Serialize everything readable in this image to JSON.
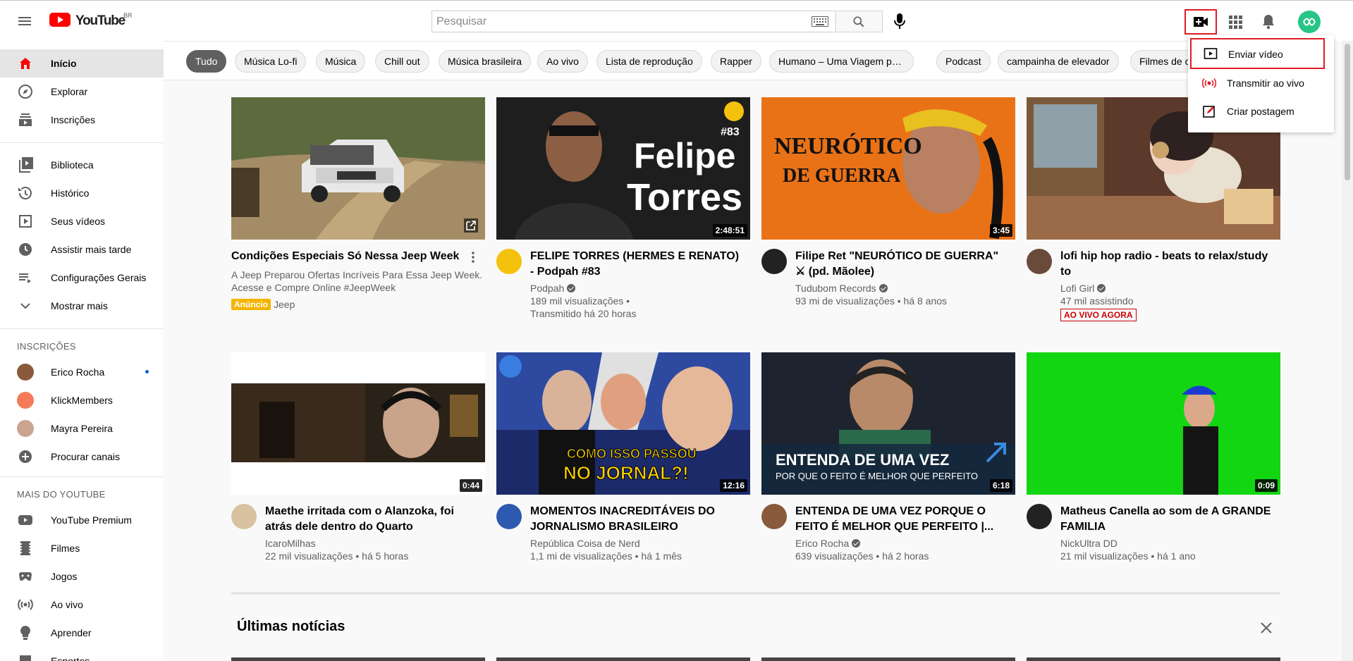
{
  "header": {
    "logo_text": "YouTube",
    "country_code": "BR",
    "search_placeholder": "Pesquisar",
    "icons": [
      "menu-icon",
      "youtube-logo",
      "keyboard-icon",
      "search-icon",
      "mic-icon",
      "create-video-icon",
      "apps-grid-icon",
      "bell-icon",
      "avatar"
    ]
  },
  "create_menu": {
    "items": [
      {
        "label": "Enviar vídeo",
        "icon": "upload-video-icon"
      },
      {
        "label": "Transmitir ao vivo",
        "icon": "live-broadcast-icon"
      },
      {
        "label": "Criar postagem",
        "icon": "create-post-icon"
      }
    ]
  },
  "sidebar": {
    "main": [
      {
        "label": "Início",
        "icon": "home-icon",
        "active": true
      },
      {
        "label": "Explorar",
        "icon": "explore-icon"
      },
      {
        "label": "Inscrições",
        "icon": "subscriptions-icon"
      }
    ],
    "library": [
      {
        "label": "Biblioteca",
        "icon": "library-icon"
      },
      {
        "label": "Histórico",
        "icon": "history-icon"
      },
      {
        "label": "Seus vídeos",
        "icon": "your-videos-icon"
      },
      {
        "label": "Assistir mais tarde",
        "icon": "watch-later-icon"
      },
      {
        "label": "Configurações Gerais",
        "icon": "playlist-icon"
      },
      {
        "label": "Mostrar mais",
        "icon": "chevron-down-icon"
      }
    ],
    "subscriptions_heading": "INSCRIÇÕES",
    "subscriptions": [
      {
        "label": "Erico Rocha",
        "new": true
      },
      {
        "label": "KlickMembers"
      },
      {
        "label": "Mayra Pereira"
      },
      {
        "label": "Procurar canais",
        "icon": "add-circle-icon"
      }
    ],
    "more_heading": "MAIS DO YOUTUBE",
    "more": [
      {
        "label": "YouTube Premium",
        "icon": "youtube-premium-icon"
      },
      {
        "label": "Filmes",
        "icon": "movies-icon"
      },
      {
        "label": "Jogos",
        "icon": "gaming-icon"
      },
      {
        "label": "Ao vivo",
        "icon": "live-icon"
      },
      {
        "label": "Aprender",
        "icon": "learning-icon"
      },
      {
        "label": "Esportes",
        "icon": "sports-icon"
      }
    ]
  },
  "chips": [
    "Tudo",
    "Música Lo-fi",
    "Música",
    "Chill out",
    "Música brasileira",
    "Ao vivo",
    "Lista de reprodução",
    "Rapper",
    "Humano – Uma Viagem pela ...",
    "Podcast",
    "campainha de elevador",
    "Filmes de c"
  ],
  "videos": {
    "ad": {
      "title": "Condições Especiais Só Nessa Jeep Week",
      "description": "A Jeep Preparou Ofertas Incríveis Para Essa Jeep Week. Acesse e Compre Online #JeepWeek",
      "badge": "Anúncio",
      "advertiser": "Jeep"
    },
    "row1": [
      {
        "title": "FELIPE TORRES (HERMES E RENATO) - Podpah #83",
        "channel": "Podpah",
        "verified": true,
        "meta": "189 mil visualizações •",
        "meta2": "Transmitido há 20 horas",
        "duration": "2:48:51"
      },
      {
        "title": "Filipe Ret \"NEURÓTICO DE GUERRA\" ⚔ (pd. Mãolee)",
        "channel": "Tudubom Records",
        "verified": true,
        "meta": "93 mi de visualizações • há 8 anos",
        "duration": "3:45"
      },
      {
        "title": "lofi hip hop radio - beats to relax/study to",
        "channel": "Lofi Girl",
        "verified": true,
        "meta": "47 mil assistindo",
        "live_badge": "AO VIVO AGORA"
      }
    ],
    "row2": [
      {
        "title": "Maethe irritada com o Alanzoka, foi atrás dele dentro do Quarto mandando...",
        "channel": "IcaroMilhas",
        "meta": "22 mil visualizações • há 5 horas",
        "duration": "0:44"
      },
      {
        "title": "MOMENTOS INACREDITÁVEIS DO JORNALISMO BRASILEIRO",
        "channel": "República Coisa de Nerd",
        "meta": "1,1 mi de visualizações • há 1 mês",
        "duration": "12:16"
      },
      {
        "title": "ENTENDA DE UMA VEZ PORQUE O FEITO É MELHOR QUE PERFEITO |...",
        "channel": "Erico Rocha",
        "verified": true,
        "meta": "639 visualizações • há 2 horas",
        "duration": "6:18"
      },
      {
        "title": "Matheus Canella ao som de A GRANDE FAMILIA",
        "channel": "NickUltra DD",
        "meta": "21 mil visualizações • há 1 ano",
        "duration": "0:09"
      }
    ]
  },
  "thumb_text": {
    "felipe1": "Felipe",
    "felipe2": "Torres",
    "episode": "#83",
    "neurotico1": "NEURÓTICO",
    "neurotico2": "DE GUERRA",
    "jornal1": "COMO ISSO PASSOU",
    "jornal2": "NO JORNAL?!",
    "entenda1": "ENTENDA DE UMA VEZ",
    "entenda2": "POR QUE O FEITO É MELHOR QUE PERFEITO"
  },
  "news": {
    "title": "Últimas notícias"
  },
  "colors": {
    "brand_red": "#ff0000",
    "highlight_red": "#e01b24",
    "avatar_green": "#27c486"
  }
}
